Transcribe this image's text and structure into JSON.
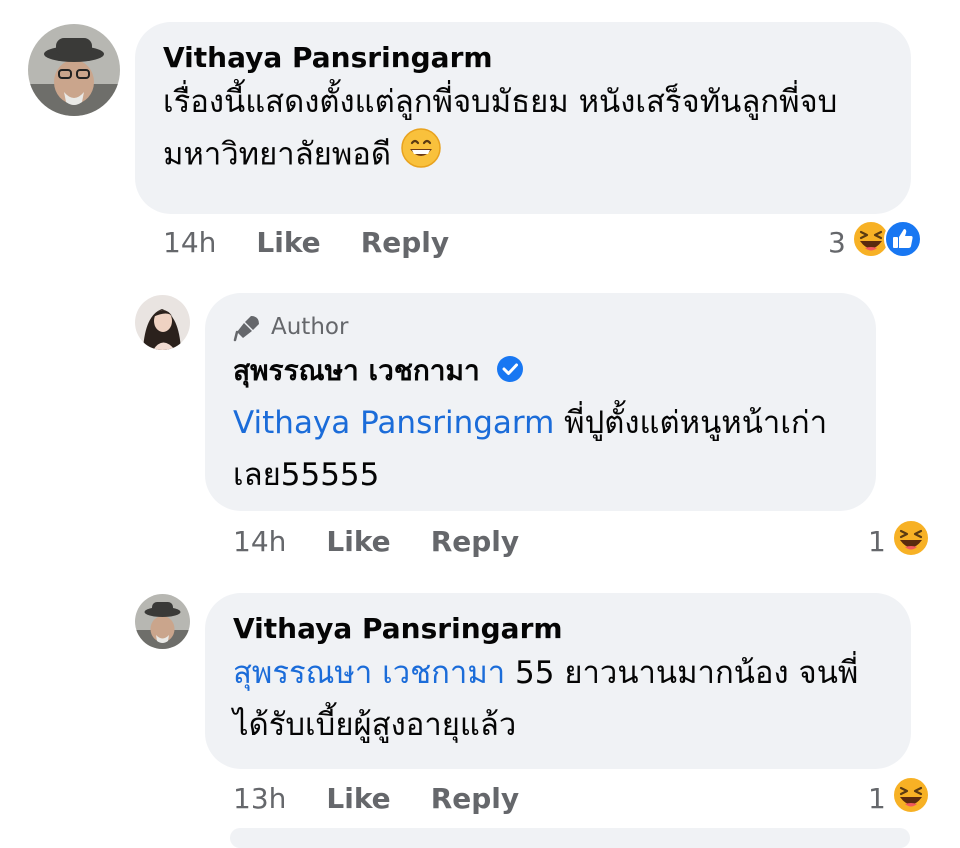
{
  "comments": [
    {
      "author": "Vithaya Pansringarm",
      "text": "เรื่องนี้แสดงตั้งแต่ลูกพี่จบมัธยม หนังเสร็จทันลูกพี่จบมหาวิทยาลัยพอดี",
      "emoji": "grinning-face",
      "time": "14h",
      "like_label": "Like",
      "reply_label": "Reply",
      "reaction_count": "3",
      "reactions": [
        "haha",
        "like"
      ]
    },
    {
      "badge": "Author",
      "author": "สุพรรณษา เวชกามา",
      "verified": true,
      "mention": "Vithaya Pansringarm",
      "text": "พี่ปูตั้งแต่หนูหน้าเก่าเลย55555",
      "time": "14h",
      "like_label": "Like",
      "reply_label": "Reply",
      "reaction_count": "1",
      "reactions": [
        "haha"
      ]
    },
    {
      "author": "Vithaya Pansringarm",
      "mention": "สุพรรณษา เวชกามา",
      "text": "55 ยาวนานมากน้อง จนพี่ได้รับเบี้ยผู้สูงอายุแล้ว",
      "time": "13h",
      "like_label": "Like",
      "reply_label": "Reply",
      "reaction_count": "1",
      "reactions": [
        "haha"
      ]
    }
  ],
  "colors": {
    "bubble": "#f0f2f5",
    "mention": "#1b6cd9",
    "meta": "#65676b",
    "like_blue": "#1877f2",
    "haha_yellow": "#f7b125"
  }
}
